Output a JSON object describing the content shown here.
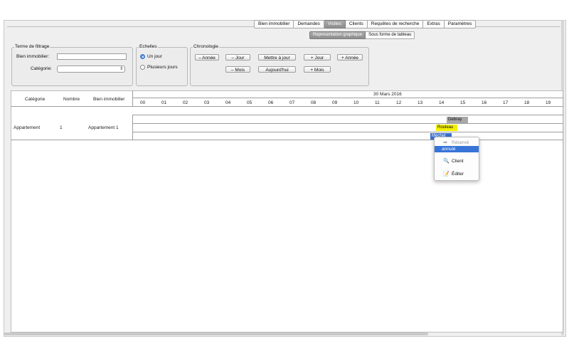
{
  "tabs": [
    "Bien immobilier",
    "Demandes",
    "Visites",
    "Clients",
    "Requêtes de recherche",
    "Extras",
    "Paramètres"
  ],
  "active_tab": "Visites",
  "subtabs": [
    "Representation graphique",
    "Sous forme de tableau"
  ],
  "active_subtab": "Representation graphique",
  "filter": {
    "title": "Terme de filtrage",
    "bien_label": "Bien immobilier:",
    "bien_value": "",
    "categorie_label": "Catégorie:",
    "categorie_value": "",
    "select_arrows": "⇕"
  },
  "echelles": {
    "title": "Echelles",
    "option1": "Un jour",
    "option2": "Plusieurs jours",
    "selected": "Un jour"
  },
  "chronologie": {
    "title": "Chronologie",
    "minus_annee": "– Année",
    "minus_jour": "– Jour",
    "mettre": "Mettre à jour",
    "plus_jour": "+ Jour",
    "plus_annee": "+ Année",
    "minus_mois": "– Mois",
    "aujourdhui": "Aujourd'hui",
    "plus_mois": "+ Mois"
  },
  "grid": {
    "col_categorie": "Catégorie",
    "col_nombre": "Nombre",
    "col_bien": "Bien immobilier",
    "date": "30 Mars 2016",
    "hours": [
      "00",
      "01",
      "02",
      "03",
      "04",
      "05",
      "06",
      "07",
      "08",
      "09",
      "10",
      "11",
      "12",
      "13",
      "14",
      "15",
      "16",
      "17",
      "18",
      "19"
    ],
    "rows": [
      {
        "categorie": "Appartement",
        "nombre": "1",
        "bien": "Appartement 1"
      }
    ]
  },
  "bars": {
    "debray": "Debray",
    "rouleau": "Rouleau",
    "mechet": "Mechet"
  },
  "menu": {
    "reserve": "Réservé",
    "annule": "annulé",
    "client": "Client",
    "editer": "Éditer"
  },
  "colors": {
    "debray": "#a8a8a8",
    "rouleau": "#f4f000",
    "mechet": "#3a6fd0",
    "selection": "#3874d8"
  }
}
